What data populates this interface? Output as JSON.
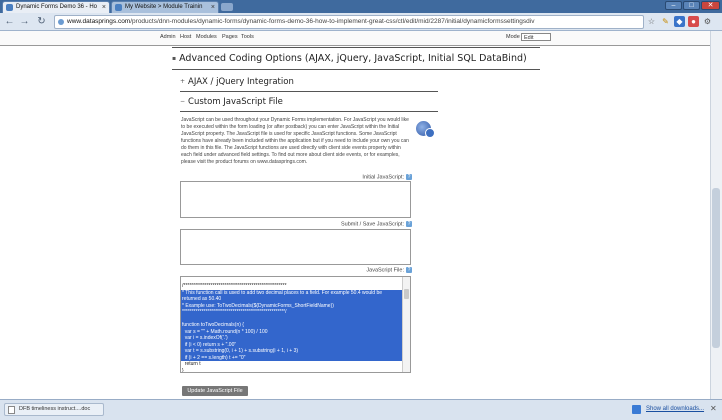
{
  "browser": {
    "tabs": [
      {
        "title": "Dynamic Forms Demo 36 - Ho",
        "active": true
      },
      {
        "title": "My Website > Module Trainin",
        "active": false
      }
    ],
    "window_controls": {
      "minimize": "–",
      "maximize": "□",
      "close": "✕"
    },
    "url": {
      "host": "www.datasprings.com",
      "path": "/products/dnn-modules/dynamic-forms/dynamic-forms-demo-36-how-to-implement-great-css/ctl/edit/mid/2287/initial/dynamicformssettingsdiv"
    }
  },
  "admin_bar": {
    "links": [
      "Admin",
      "Host",
      "Modules",
      "Pages",
      "Tools"
    ],
    "mode_label": "Mode",
    "mode_value": "Edit"
  },
  "sections": {
    "advanced": "Advanced Coding Options (AJAX, jQuery, JavaScript, Initial SQL DataBind)",
    "ajax": "AJAX / jQuery Integration",
    "custom_js": "Custom JavaScript File"
  },
  "custom_js": {
    "description": "JavaScript can be used throughout your Dynamic Forms implementation. For JavaScript you would like to be executed within the form loading (or after postback) you can enter JavaScript within the Initial JavaScript property. The JavaScript file is used for specific JavaScript functions. Some JavaScript functions have already been included within the application but if you need to include your own you can do them in this file. The JavaScript functions are used directly with client side events property within each field under advanced field settings. To find out more about client side events, or for examples, please visit the product forums on www.datasprings.com.",
    "initial_label": "Initial JavaScript:",
    "submit_label": "Submit / Save JavaScript:",
    "file_label": "JavaScript File:",
    "code_lines": [
      "/*****************************************************",
      "* This function call is used to add two decimal places to a field. For example 50.4 would be",
      "returned as 50.40",
      "* Example use: ToTwoDecimals($(DynamicForms_ShortFieldName))",
      "*****************************************************/",
      "",
      "function toTwoDecimals(n) {",
      "  var s = \"\" + Math.round(n * 100) / 100",
      "  var i = s.indexOf('.')",
      "  if (i < 0) return s + \".00\"",
      "  var t = s.substring(0, i + 1) + s.substring(i + 1, i + 3)",
      "  if (i + 2 == s.length) t += \"0\"",
      "  return t",
      "}"
    ],
    "update_button": "Update JavaScript File"
  },
  "download_bar": {
    "item": "DFB timeliness instruct....doc",
    "show_all": "Show all downloads..."
  }
}
